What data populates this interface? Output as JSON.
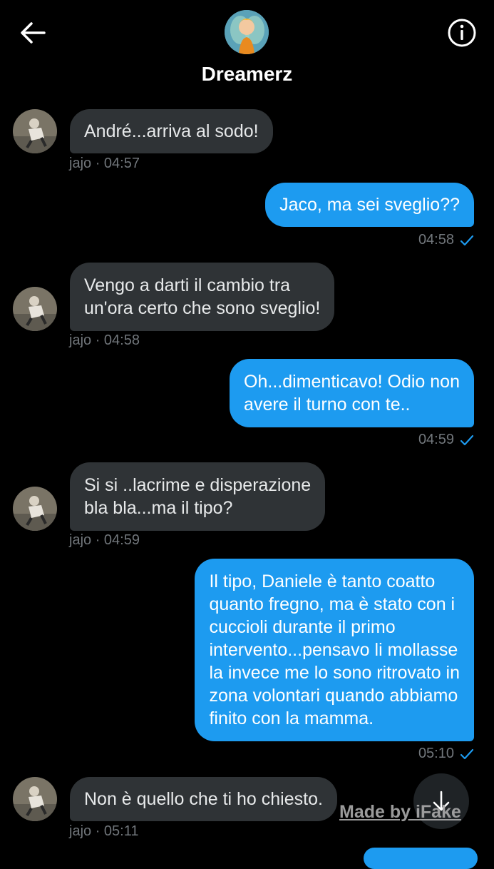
{
  "header": {
    "title": "Dreamerz",
    "back_icon": "arrow-left-icon",
    "info_icon": "info-icon"
  },
  "colors": {
    "background": "#000000",
    "incoming_bubble": "#2f3336",
    "outgoing_bubble": "#1d9bf0",
    "meta_text": "#71767b",
    "read_check": "#1d9bf0"
  },
  "messages": [
    {
      "direction": "in",
      "text": "André...arriva al sodo!",
      "meta": "jajo · 04:57"
    },
    {
      "direction": "out",
      "text": "Jaco, ma sei sveglio??",
      "meta": "04:58"
    },
    {
      "direction": "in",
      "text": "Vengo a darti il cambio tra\nun'ora certo che sono sveglio!",
      "meta": "jajo · 04:58"
    },
    {
      "direction": "out",
      "text": "Oh...dimenticavo! Odio non\navere il turno con te..",
      "meta": "04:59"
    },
    {
      "direction": "in",
      "text": "Si si ..lacrime e disperazione\nbla bla...ma il tipo?",
      "meta": "jajo · 04:59"
    },
    {
      "direction": "out",
      "text": "Il tipo, Daniele è tanto coatto\nquanto fregno, ma è stato con i\ncuccioli durante il primo\nintervento...pensavo li mollasse\nla invece me lo sono ritrovato in\nzona volontari quando abbiamo\nfinito con la mamma.",
      "meta": "05:10"
    },
    {
      "direction": "in",
      "text": "Non è quello che ti ho chiesto.",
      "meta": "jajo · 05:11"
    }
  ],
  "scroll_button": {
    "icon": "arrow-down-icon"
  },
  "watermark": "Made by iFake"
}
